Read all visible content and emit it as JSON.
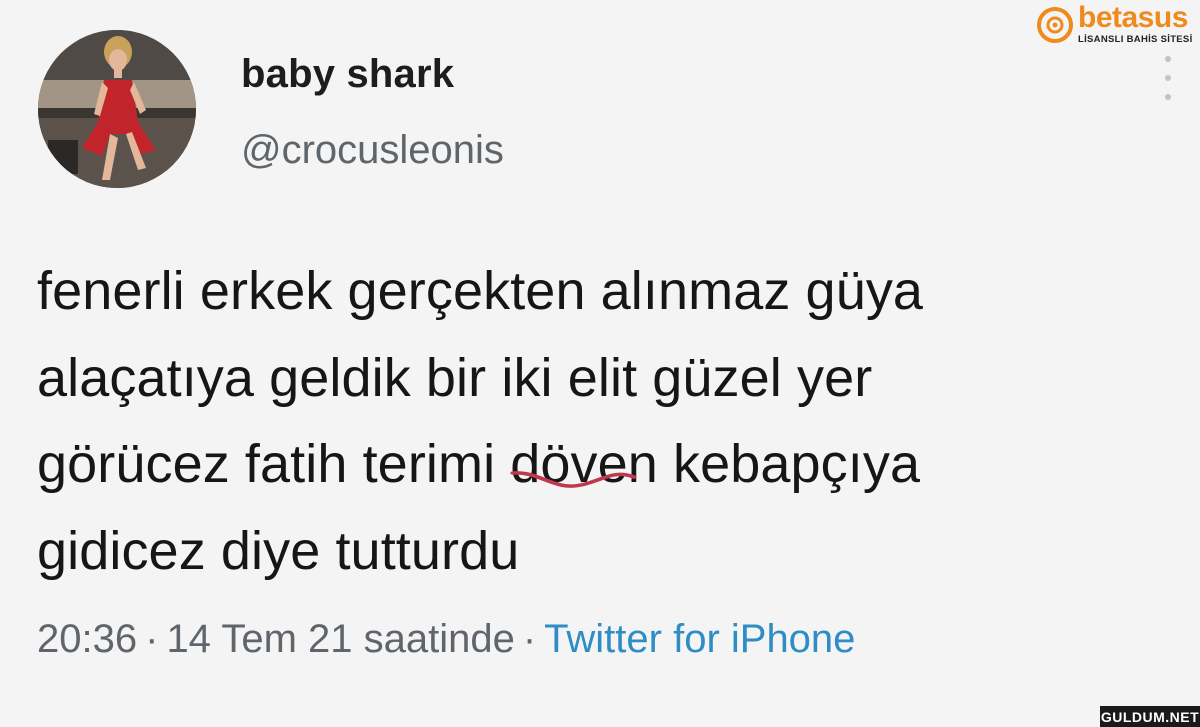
{
  "brand": {
    "name": "betasus",
    "tagline": "LİSANSLI BAHİS SİTESİ",
    "accent": "#f08a1c"
  },
  "tweet": {
    "display_name": "baby shark",
    "handle": "@crocusleonis",
    "text_lines": [
      "fenerli erkek gerçekten alınmaz güya",
      "alaçatıya geldik bir iki elit güzel yer",
      "görücez fatih terimi ",
      " kebapçıya",
      "gidicez diye tutturdu"
    ],
    "annotated_word": "döven",
    "annotation_color": "#c0384f",
    "time": "20:36",
    "date": "14 Tem 21 saatinde",
    "source": "Twitter for iPhone",
    "separator": "·",
    "source_color": "#2f8dc5"
  },
  "icons": {
    "more": "more-vertical-icon",
    "brand_mark": "target-logo-icon"
  },
  "watermark": {
    "text": "GULDUM.NET"
  }
}
